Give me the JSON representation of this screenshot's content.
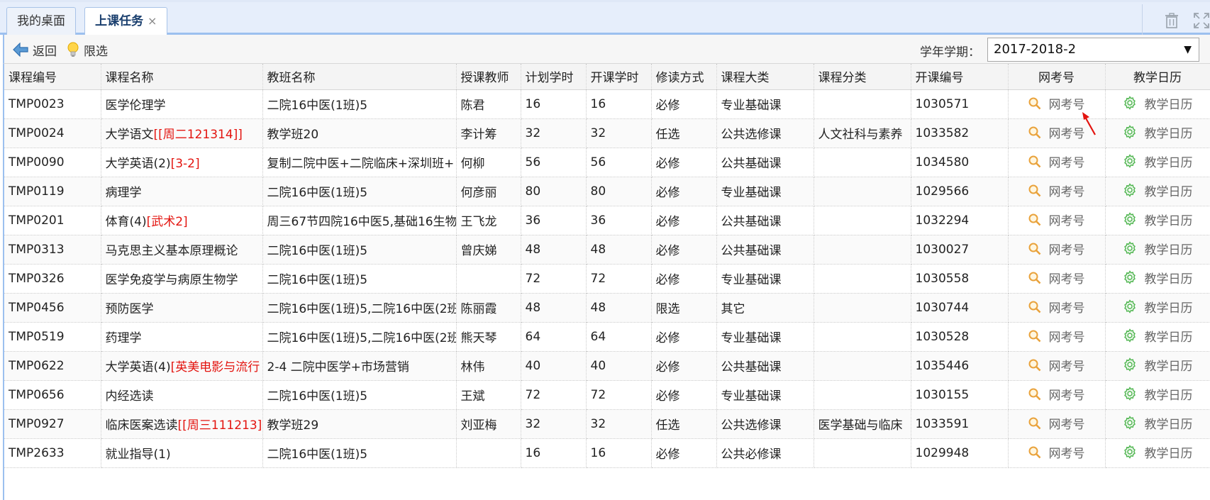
{
  "tabs": [
    {
      "label": "我的桌面",
      "active": false
    },
    {
      "label": "上课任务",
      "active": true,
      "close": "×"
    }
  ],
  "toolbar": {
    "back_label": "返回",
    "limit_label": "限选",
    "term_label": "学年学期：",
    "term_value": "2017-2018-2"
  },
  "columns": [
    "课程编号",
    "课程名称",
    "教班名称",
    "授课教师",
    "计划学时",
    "开课学时",
    "修读方式",
    "课程大类",
    "课程分类",
    "开课编号",
    "网考号",
    "教学日历"
  ],
  "action_labels": {
    "exam": "网考号",
    "calendar": "教学日历"
  },
  "rows": [
    {
      "code": "TMP0023",
      "name": "医学伦理学",
      "name_tag": "",
      "cls": "二院16中医(1班)5",
      "teacher": "陈君",
      "plan": "16",
      "open": "16",
      "mode": "必修",
      "category": "专业基础课",
      "subcat": "",
      "open_no": "1030571"
    },
    {
      "code": "TMP0024",
      "name": "大学语文",
      "name_tag": "[[周二121314]]",
      "cls": "教学班20",
      "teacher": "李计筹",
      "plan": "32",
      "open": "32",
      "mode": "任选",
      "category": "公共选修课",
      "subcat": "人文社科与素养",
      "open_no": "1033582"
    },
    {
      "code": "TMP0090",
      "name": "大学英语(2)",
      "name_tag": "[3-2]",
      "cls": "复制二院中医+二院临床+深圳班+",
      "teacher": "何柳",
      "plan": "56",
      "open": "56",
      "mode": "必修",
      "category": "公共基础课",
      "subcat": "",
      "open_no": "1034580"
    },
    {
      "code": "TMP0119",
      "name": "病理学",
      "name_tag": "",
      "cls": "二院16中医(1班)5",
      "teacher": "何彦丽",
      "plan": "80",
      "open": "80",
      "mode": "必修",
      "category": "专业基础课",
      "subcat": "",
      "open_no": "1029566"
    },
    {
      "code": "TMP0201",
      "name": "体育(4)",
      "name_tag": "[武术2]",
      "cls": "周三67节四院16中医5,基础16生物",
      "teacher": "王飞龙",
      "plan": "36",
      "open": "36",
      "mode": "必修",
      "category": "公共基础课",
      "subcat": "",
      "open_no": "1032294"
    },
    {
      "code": "TMP0313",
      "name": "马克思主义基本原理概论",
      "name_tag": "",
      "cls": "二院16中医(1班)5",
      "teacher": "曾庆娣",
      "plan": "48",
      "open": "48",
      "mode": "必修",
      "category": "公共基础课",
      "subcat": "",
      "open_no": "1030027"
    },
    {
      "code": "TMP0326",
      "name": "医学免疫学与病原生物学",
      "name_tag": "",
      "cls": "二院16中医(1班)5",
      "teacher": "",
      "plan": "72",
      "open": "72",
      "mode": "必修",
      "category": "专业基础课",
      "subcat": "",
      "open_no": "1030558"
    },
    {
      "code": "TMP0456",
      "name": "预防医学",
      "name_tag": "",
      "cls": "二院16中医(1班)5,二院16中医(2班",
      "teacher": "陈丽霞",
      "plan": "48",
      "open": "48",
      "mode": "限选",
      "category": "其它",
      "subcat": "",
      "open_no": "1030744"
    },
    {
      "code": "TMP0519",
      "name": "药理学",
      "name_tag": "",
      "cls": "二院16中医(1班)5,二院16中医(2班",
      "teacher": "熊天琴",
      "plan": "64",
      "open": "64",
      "mode": "必修",
      "category": "专业基础课",
      "subcat": "",
      "open_no": "1030528"
    },
    {
      "code": "TMP0622",
      "name": "大学英语(4)",
      "name_tag": "[英美电影与流行",
      "cls": "2-4 二院中医学+市场营销",
      "teacher": "林伟",
      "plan": "40",
      "open": "40",
      "mode": "必修",
      "category": "公共基础课",
      "subcat": "",
      "open_no": "1035446"
    },
    {
      "code": "TMP0656",
      "name": "内经选读",
      "name_tag": "",
      "cls": "二院16中医(1班)5",
      "teacher": "王斌",
      "plan": "72",
      "open": "72",
      "mode": "必修",
      "category": "专业基础课",
      "subcat": "",
      "open_no": "1030155"
    },
    {
      "code": "TMP0927",
      "name": "临床医案选读",
      "name_tag": "[[周三111213]]",
      "cls": "教学班29",
      "teacher": "刘亚梅",
      "plan": "32",
      "open": "32",
      "mode": "任选",
      "category": "公共选修课",
      "subcat": "医学基础与临床",
      "open_no": "1033591"
    },
    {
      "code": "TMP2633",
      "name": "就业指导(1)",
      "name_tag": "",
      "cls": "二院16中医(1班)5",
      "teacher": "",
      "plan": "16",
      "open": "16",
      "mode": "必修",
      "category": "公共必修课",
      "subcat": "",
      "open_no": "1029948"
    }
  ],
  "colors": {
    "accent": "#9cc0ef",
    "tag_red": "#e3140f",
    "calendar_green": "#4fb54f",
    "search_orange": "#e9a23b",
    "arrow_red": "#e3140f"
  }
}
